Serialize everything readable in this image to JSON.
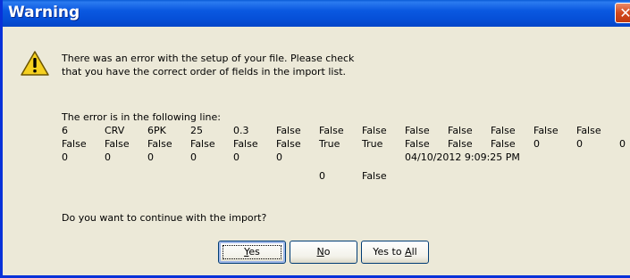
{
  "dialog": {
    "title": "Warning",
    "close_glyph": "✕"
  },
  "message": {
    "line1": "There was an error with the setup of your file. Please check",
    "line2": "that you have the correct order of fields in the import list."
  },
  "error": {
    "intro": "The error is in the following line:",
    "row1": [
      "6",
      "CRV",
      "6PK",
      "25",
      "0.3",
      "False",
      "False",
      "False",
      "False",
      "False",
      "False",
      "False",
      "False"
    ],
    "row2": [
      "False",
      "False",
      "False",
      "False",
      "False",
      "False",
      "True",
      "True",
      "False",
      "False",
      "False",
      "0",
      "0",
      "0"
    ],
    "row3": [
      "0",
      "0",
      "0",
      "0",
      "0",
      "0",
      "04/10/2012 9:09:25 PM"
    ],
    "row4": [
      "0",
      "False"
    ]
  },
  "question": "Do you want to continue with the import?",
  "buttons": {
    "yes": {
      "prefix": "",
      "accel": "Y",
      "suffix": "es"
    },
    "no": {
      "prefix": "",
      "accel": "N",
      "suffix": "o"
    },
    "yes_to_all": {
      "prefix": "Yes to ",
      "accel": "A",
      "suffix": "ll"
    }
  },
  "icons": {
    "warning": "warning-icon",
    "close": "close-icon"
  },
  "colors": {
    "titlebar": "#0a58e0",
    "close": "#d24a1e",
    "dialog_bg": "#ece9d8"
  }
}
